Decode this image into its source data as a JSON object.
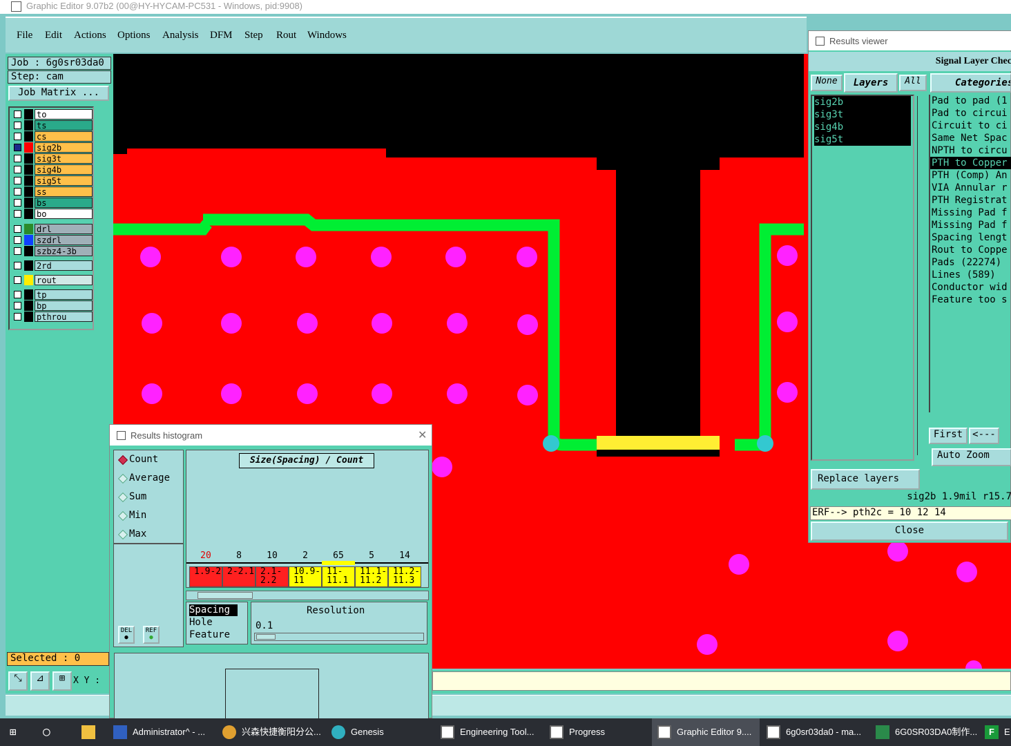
{
  "window": {
    "title": "Graphic Editor 9.07b2 (00@HY-HYCAM-PC531 - Windows, pid:9908)"
  },
  "menu": [
    "File",
    "Edit",
    "Actions",
    "Options",
    "Analysis",
    "DFM",
    "Step",
    "Rout",
    "Windows"
  ],
  "job": {
    "job_label": "Job : 6g0sr03da0",
    "step_label": "Step: cam",
    "matrix_button": "Job Matrix ..."
  },
  "layers": [
    {
      "name": "to",
      "color": "#ffffff"
    },
    {
      "name": "ts",
      "color": "#2aaa8a"
    },
    {
      "name": "cs",
      "color": "#ffc04a"
    },
    {
      "name": "sig2b",
      "color": "#ffc04a",
      "selected": true
    },
    {
      "name": "sig3t",
      "color": "#ffc04a"
    },
    {
      "name": "sig4b",
      "color": "#ffc04a"
    },
    {
      "name": "sig5t",
      "color": "#ffc04a"
    },
    {
      "name": "ss",
      "color": "#ffc04a"
    },
    {
      "name": "bs",
      "color": "#2aaa8a"
    },
    {
      "name": "bo",
      "color": "#ffffff"
    },
    {
      "name": "drl",
      "color": "#a0b0b8"
    },
    {
      "name": "szdrl",
      "color": "#a0b0b8"
    },
    {
      "name": "szbz4-3b",
      "color": "#a0b0b8"
    },
    {
      "name": "2rd",
      "color": "#a8dcdc"
    },
    {
      "name": "rout",
      "color": "#cfe8e6"
    },
    {
      "name": "tp",
      "color": "#a8dcdc"
    },
    {
      "name": "bp",
      "color": "#a8dcdc"
    },
    {
      "name": "pthrou",
      "color": "#a8dcdc"
    }
  ],
  "selected_label": "Selected : 0",
  "xy_label": "X Y :",
  "results_viewer": {
    "title": "Results viewer",
    "header": "Signal Layer Chec",
    "none_btn": "None",
    "layers_btn": "Layers",
    "all_btn": "All",
    "categories_btn": "Categories",
    "layer_items": [
      "sig2b",
      "sig3t",
      "sig4b",
      "sig5t"
    ],
    "categories": [
      "Pad to pad (1",
      "Pad to circui",
      "Circuit to ci",
      "Same Net Spac",
      "NPTH to circu",
      "PTH to Copper",
      "PTH (Comp) An",
      "VIA Annular r",
      "PTH Registrat",
      "Missing Pad f",
      "Missing Pad f",
      "Spacing lengt",
      "Rout to Coppe",
      "Pads (22274)",
      "Lines (589)",
      "Conductor wid",
      "Feature too s"
    ],
    "first_btn": "First",
    "prev_btn": "<---",
    "auto_zoom": "Auto Zoom",
    "replace_layers": "Replace layers",
    "info_line": "sig2b 1.9mil  r15.7",
    "erf_line": "ERF--> pth2c = 10 12 14",
    "close_btn": "Close"
  },
  "histogram": {
    "title": "Results histogram",
    "modes": [
      "Count",
      "Average",
      "Sum",
      "Min",
      "Max"
    ],
    "chart_title": "Size(Spacing) / Count",
    "del_btn": "DEL",
    "ref_btn": "REF",
    "types": [
      "Spacing",
      "Hole",
      "Feature"
    ],
    "resolution_label": "Resolution",
    "resolution_value": "0.1"
  },
  "chart_data": {
    "type": "bar",
    "title": "Size(Spacing) / Count",
    "categories": [
      "1.9-2",
      "2-2.1",
      "2.1-2.2",
      "10.9-11",
      "11-11.1",
      "11.1-11.2",
      "11.2-11.3"
    ],
    "values": [
      20,
      8,
      10,
      2,
      65,
      5,
      14
    ],
    "colors": [
      "#ff2020",
      "#ff2020",
      "#ff2020",
      "#ffff00",
      "#ffff00",
      "#ffff00",
      "#ffff00"
    ]
  },
  "taskbar": [
    {
      "label": "Administrator^ - ..."
    },
    {
      "label": "兴森快捷衡阳分公..."
    },
    {
      "label": "Genesis"
    },
    {
      "label": "Engineering Tool..."
    },
    {
      "label": "Progress"
    },
    {
      "label": "Graphic Editor 9...."
    },
    {
      "label": "6g0sr03da0 - ma..."
    },
    {
      "label": "6G0SR03DA0制作..."
    },
    {
      "label": "E"
    }
  ]
}
